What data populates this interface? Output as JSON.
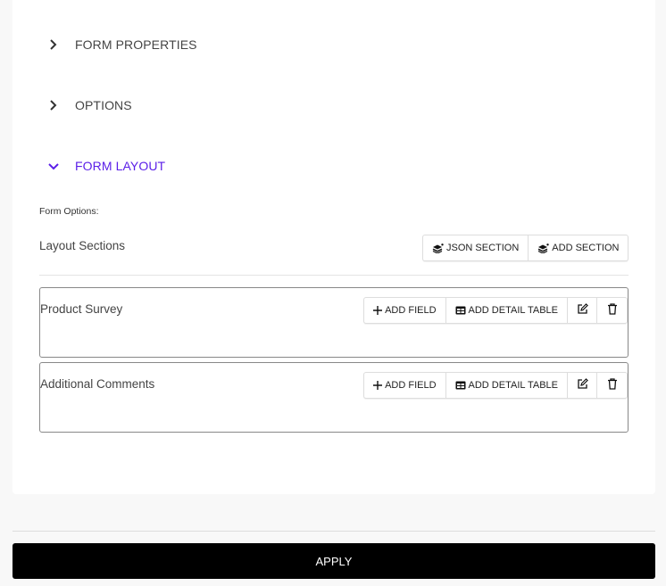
{
  "accordion": [
    {
      "label": "FORM PROPERTIES",
      "expanded": false,
      "icon": "chevron-right-icon"
    },
    {
      "label": "OPTIONS",
      "expanded": false,
      "icon": "chevron-right-icon"
    },
    {
      "label": "FORM LAYOUT",
      "expanded": true,
      "icon": "chevron-down-icon"
    }
  ],
  "colors": {
    "active": "#5b1fe8",
    "apply_bg": "#000000"
  },
  "form_layout": {
    "form_options_label": "Form Options:",
    "layout_sections_title": "Layout Sections",
    "json_section_label": "JSON SECTION",
    "add_section_label": "ADD SECTION",
    "sections": [
      {
        "name": "Product Survey",
        "add_field_label": "ADD FIELD",
        "add_detail_table_label": "ADD DETAIL TABLE"
      },
      {
        "name": "Additional Comments",
        "add_field_label": "ADD FIELD",
        "add_detail_table_label": "ADD DETAIL TABLE"
      }
    ]
  },
  "footer": {
    "apply_label": "APPLY"
  }
}
